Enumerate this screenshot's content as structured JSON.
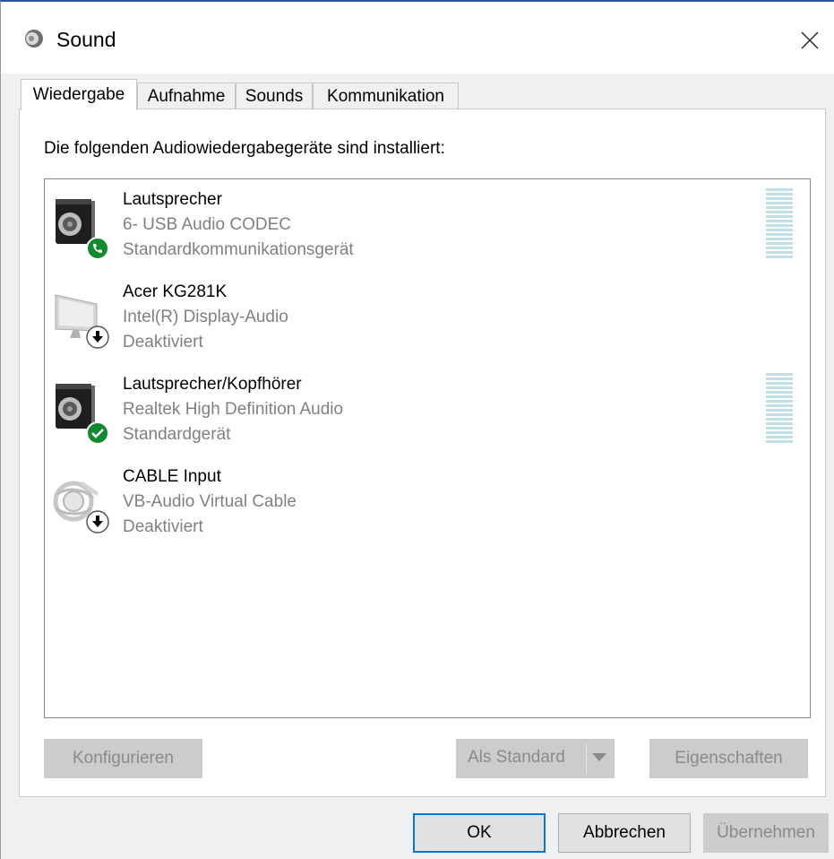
{
  "window": {
    "title": "Sound"
  },
  "tabs": [
    {
      "label": "Wiedergabe",
      "active": true
    },
    {
      "label": "Aufnahme",
      "active": false
    },
    {
      "label": "Sounds",
      "active": false
    },
    {
      "label": "Kommunikation",
      "active": false
    }
  ],
  "playback": {
    "intro": "Die folgenden Audiowiedergabegeräte sind installiert:",
    "devices": [
      {
        "name": "Lautsprecher",
        "driver": "6- USB Audio CODEC",
        "status": "Standardkommunikationsgerät",
        "icon": "speaker-icon",
        "badge": "phone-badge-icon",
        "meter": true
      },
      {
        "name": "Acer KG281K",
        "driver": "Intel(R) Display-Audio",
        "status": "Deaktiviert",
        "icon": "monitor-icon",
        "badge": "disabled-badge-icon",
        "meter": false
      },
      {
        "name": "Lautsprecher/Kopfhörer",
        "driver": "Realtek High Definition Audio",
        "status": "Standardgerät",
        "icon": "speaker-icon",
        "badge": "check-badge-icon",
        "meter": true
      },
      {
        "name": "CABLE Input",
        "driver": "VB-Audio Virtual Cable",
        "status": "Deaktiviert",
        "icon": "cable-icon",
        "badge": "disabled-badge-icon",
        "meter": false
      }
    ],
    "buttons": {
      "configure": "Konfigurieren",
      "set_default": "Als Standard",
      "properties": "Eigenschaften"
    }
  },
  "footer": {
    "ok": "OK",
    "cancel": "Abbrechen",
    "apply": "Übernehmen"
  },
  "colors": {
    "accent": "#0078d7",
    "meter": "#bfe0e6",
    "badge_green": "#0f8a2e",
    "window_border": "#2b5797"
  }
}
